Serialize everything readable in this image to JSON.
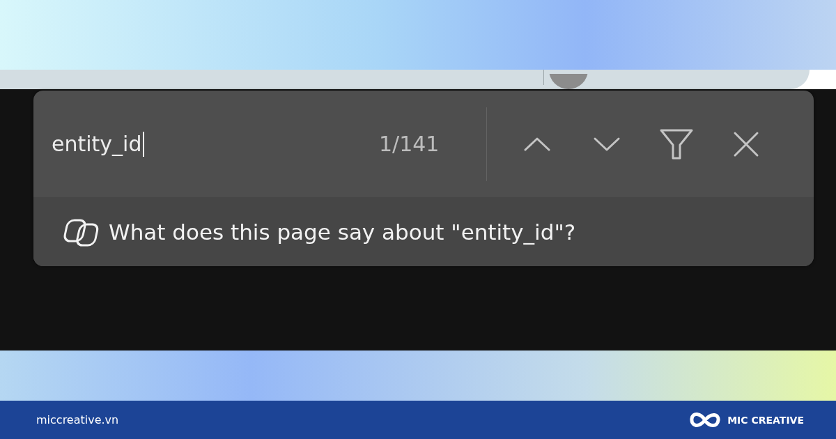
{
  "find_bar": {
    "query": "entity_id",
    "match_count": "1/141"
  },
  "copilot_prompt": "What does this page say about \"entity_id\"?",
  "footer": {
    "site": "miccreative.vn",
    "brand": "MIC CREATIVE"
  }
}
